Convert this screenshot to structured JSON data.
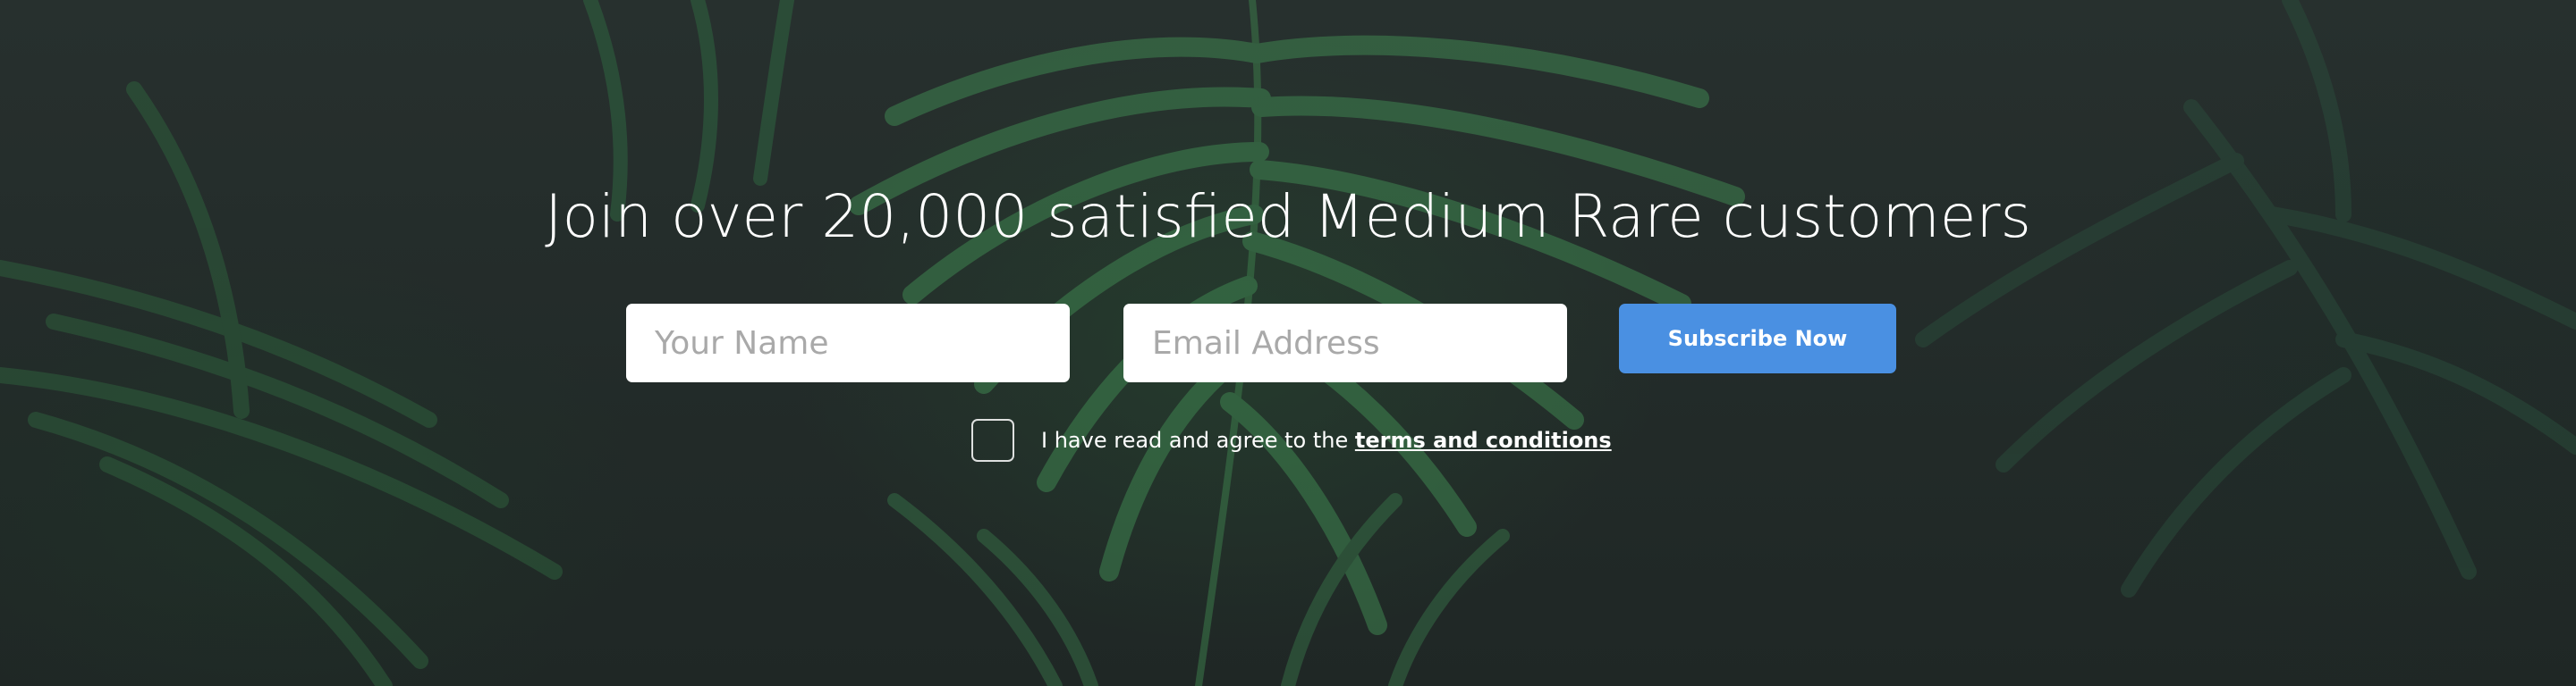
{
  "headline": "Join over 20,000 satisfied Medium Rare customers",
  "form": {
    "name_placeholder": "Your Name",
    "email_placeholder": "Email Address",
    "subscribe_label": "Subscribe Now",
    "agree_prefix": "I have read and agree to the ",
    "terms_link": "terms and conditions",
    "agree_checked": false
  },
  "colors": {
    "background": "#222a28",
    "foliage": "#2f5a3a",
    "button": "#4a90e2",
    "text": "#ffffff"
  },
  "icons": {
    "background": "palm-leaves-photo"
  }
}
